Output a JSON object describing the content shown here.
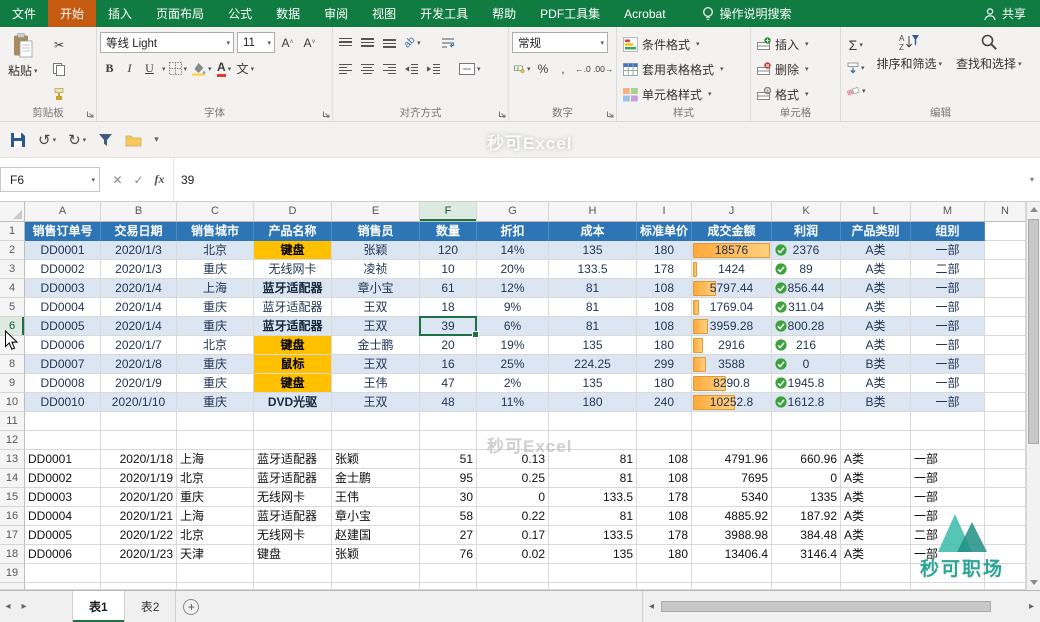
{
  "app": {
    "menu_tabs": [
      "文件",
      "开始",
      "插入",
      "页面布局",
      "公式",
      "数据",
      "审阅",
      "视图",
      "开发工具",
      "帮助",
      "PDF工具集",
      "Acrobat"
    ],
    "active_tab": "开始",
    "search_hint": "操作说明搜索",
    "share_label": "共享"
  },
  "ribbon": {
    "clipboard": {
      "label": "剪贴板",
      "paste": "粘贴"
    },
    "font": {
      "label": "字体",
      "name": "等线 Light",
      "size": "11"
    },
    "alignment": {
      "label": "对齐方式"
    },
    "number": {
      "label": "数字",
      "format": "常规"
    },
    "styles": {
      "label": "样式",
      "items": [
        "条件格式",
        "套用表格格式",
        "单元格样式"
      ]
    },
    "cells": {
      "label": "单元格",
      "items": [
        "插入",
        "删除",
        "格式"
      ]
    },
    "editing": {
      "label": "编辑",
      "sum": "Σ",
      "sort": "排序和筛选",
      "find": "查找和选择"
    }
  },
  "formula_bar": {
    "name_box": "F6",
    "value": "39"
  },
  "sheet": {
    "tabs": [
      {
        "label": "表1",
        "active": true
      },
      {
        "label": "表2",
        "active": false
      }
    ],
    "selection": {
      "col": "F",
      "row": 6
    }
  },
  "grid": {
    "columns": [
      "A",
      "B",
      "C",
      "D",
      "E",
      "F",
      "G",
      "H",
      "I",
      "J",
      "K",
      "L",
      "M",
      "N"
    ],
    "header": [
      "销售订单号",
      "交易日期",
      "销售城市",
      "产品名称",
      "销售员",
      "数量",
      "折扣",
      "成本",
      "标准单价",
      "成交金额",
      "利润",
      "产品类别",
      "组别"
    ],
    "table1_start_row": 2,
    "table1": [
      {
        "order": "DD0001",
        "date": "2020/1/3",
        "city": "北京",
        "product": "键盘",
        "product_fill": true,
        "product_bold": true,
        "seller": "张颖",
        "qty": "120",
        "discount": "14%",
        "cost": "135",
        "price": "180",
        "amount": 18576,
        "amount_text": "18576",
        "profit": "2376",
        "category": "A类",
        "group": "一部"
      },
      {
        "order": "DD0002",
        "date": "2020/1/3",
        "city": "重庆",
        "product": "无线网卡",
        "product_fill": false,
        "product_bold": false,
        "seller": "凌祯",
        "qty": "10",
        "discount": "20%",
        "cost": "133.5",
        "price": "178",
        "amount": 1424,
        "amount_text": "1424",
        "profit": "89",
        "category": "A类",
        "group": "二部"
      },
      {
        "order": "DD0003",
        "date": "2020/1/4",
        "city": "上海",
        "product": "蓝牙适配器",
        "product_fill": false,
        "product_bold": true,
        "seller": "章小宝",
        "qty": "61",
        "discount": "12%",
        "cost": "81",
        "price": "108",
        "amount": 5797.44,
        "amount_text": "5797.44",
        "profit": "856.44",
        "category": "A类",
        "group": "一部"
      },
      {
        "order": "DD0004",
        "date": "2020/1/4",
        "city": "重庆",
        "product": "蓝牙适配器",
        "product_fill": false,
        "product_bold": false,
        "seller": "王双",
        "qty": "18",
        "discount": "9%",
        "cost": "81",
        "price": "108",
        "amount": 1769.04,
        "amount_text": "1769.04",
        "profit": "311.04",
        "category": "A类",
        "group": "一部"
      },
      {
        "order": "DD0005",
        "date": "2020/1/4",
        "city": "重庆",
        "product": "蓝牙适配器",
        "product_fill": false,
        "product_bold": true,
        "seller": "王双",
        "qty": "39",
        "discount": "6%",
        "cost": "81",
        "price": "108",
        "amount": 3959.28,
        "amount_text": "3959.28",
        "profit": "800.28",
        "category": "A类",
        "group": "一部"
      },
      {
        "order": "DD0006",
        "date": "2020/1/7",
        "city": "北京",
        "product": "键盘",
        "product_fill": true,
        "product_bold": true,
        "seller": "金士鹏",
        "qty": "20",
        "discount": "19%",
        "cost": "135",
        "price": "180",
        "amount": 2916,
        "amount_text": "2916",
        "profit": "216",
        "category": "A类",
        "group": "一部"
      },
      {
        "order": "DD0007",
        "date": "2020/1/8",
        "city": "重庆",
        "product": "鼠标",
        "product_fill": true,
        "product_bold": true,
        "seller": "王双",
        "qty": "16",
        "discount": "25%",
        "cost": "224.25",
        "price": "299",
        "amount": 3588,
        "amount_text": "3588",
        "profit": "0",
        "category": "B类",
        "group": "一部"
      },
      {
        "order": "DD0008",
        "date": "2020/1/9",
        "city": "重庆",
        "product": "键盘",
        "product_fill": true,
        "product_bold": true,
        "seller": "王伟",
        "qty": "47",
        "discount": "2%",
        "cost": "135",
        "price": "180",
        "amount": 8290.8,
        "amount_text": "8290.8",
        "profit": "1945.8",
        "category": "A类",
        "group": "一部"
      },
      {
        "order": "DD0010",
        "date": "2020/1/10",
        "city": "重庆",
        "product": "DVD光驱",
        "product_fill": false,
        "product_bold": true,
        "seller": "王双",
        "qty": "48",
        "discount": "11%",
        "cost": "180",
        "price": "240",
        "amount": 10252.8,
        "amount_text": "10252.8",
        "profit": "1612.8",
        "category": "B类",
        "group": "一部"
      }
    ],
    "table2_start_row": 13,
    "table2": [
      {
        "order": "DD0001",
        "date": "2020/1/18",
        "city": "上海",
        "product": "蓝牙适配器",
        "seller": "张颖",
        "qty": "51",
        "discount": "0.13",
        "cost": "81",
        "price": "108",
        "amount": "4791.96",
        "profit": "660.96",
        "category": "A类",
        "group": "一部"
      },
      {
        "order": "DD0002",
        "date": "2020/1/19",
        "city": "北京",
        "product": "蓝牙适配器",
        "seller": "金士鹏",
        "qty": "95",
        "discount": "0.25",
        "cost": "81",
        "price": "108",
        "amount": "7695",
        "profit": "0",
        "category": "A类",
        "group": "一部"
      },
      {
        "order": "DD0003",
        "date": "2020/1/20",
        "city": "重庆",
        "product": "无线网卡",
        "seller": "王伟",
        "qty": "30",
        "discount": "0",
        "cost": "133.5",
        "price": "178",
        "amount": "5340",
        "profit": "1335",
        "category": "A类",
        "group": "一部"
      },
      {
        "order": "DD0004",
        "date": "2020/1/21",
        "city": "上海",
        "product": "蓝牙适配器",
        "seller": "章小宝",
        "qty": "58",
        "discount": "0.22",
        "cost": "81",
        "price": "108",
        "amount": "4885.92",
        "profit": "187.92",
        "category": "A类",
        "group": "一部"
      },
      {
        "order": "DD0005",
        "date": "2020/1/22",
        "city": "北京",
        "product": "无线网卡",
        "seller": "赵建国",
        "qty": "27",
        "discount": "0.17",
        "cost": "133.5",
        "price": "178",
        "amount": "3988.98",
        "profit": "384.48",
        "category": "A类",
        "group": "二部"
      },
      {
        "order": "DD0006",
        "date": "2020/1/23",
        "city": "天津",
        "product": "键盘",
        "seller": "张颖",
        "qty": "76",
        "discount": "0.02",
        "cost": "135",
        "price": "180",
        "amount": "13406.4",
        "profit": "3146.4",
        "category": "A类",
        "group": "一部"
      }
    ]
  },
  "watermarks": {
    "excel": "秒可Excel",
    "brand": "秒可职场"
  },
  "colors": {
    "title_green": "#107C41",
    "active_tab_orange": "#C55A11",
    "header_blue": "#2E75B6",
    "band_blue": "#DCE6F2",
    "highlight_orange": "#FFC000",
    "databar_orange": "#FFA93A",
    "check_green": "#3BA33B",
    "selection_green": "#1E7145"
  }
}
